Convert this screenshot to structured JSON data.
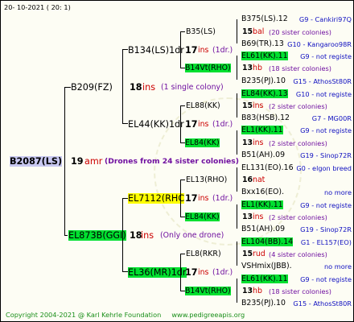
{
  "header": {
    "date": "20-  10-2021  (  20:   1)"
  },
  "root": {
    "id": "B2087(LS)",
    "num": "19",
    "ins": "amr",
    "note": "(Drones from 24 sister colonies)"
  },
  "queen": {
    "id": "B209(FZ)",
    "num": "18",
    "ins": "ins",
    "note": "(1 single colony)",
    "q1": {
      "id": "B134(LS)1dr",
      "num": "17",
      "ins": "ins",
      "note": "(1dr.)"
    },
    "q2": {
      "id": "EL44(KK)1dr",
      "num": "17",
      "ins": "ins",
      "note": "(1dr.)"
    }
  },
  "drone": {
    "id": "EL873B(GGI)",
    "num": "18",
    "ins": "ins",
    "note": "(Only one drone)",
    "q1": {
      "id": "EL7112(RHC",
      "num": "17",
      "ins": "ins",
      "note": "(1dr.)"
    },
    "q2": {
      "id": "EL36(MR)1dr",
      "num": "17",
      "ins": "ins",
      "note": "(1dr.)"
    }
  },
  "gen3": [
    {
      "id": "B35(LS)"
    },
    {
      "id": "B14Vt(RHO)"
    },
    {
      "id": "EL88(KK)"
    },
    {
      "id": "EL84(KK)"
    },
    {
      "id": "EL13(RHO)"
    },
    {
      "id": "EL84(KK)"
    },
    {
      "id": "EL8(RKR)"
    },
    {
      "id": "B14Vt(RHO)"
    }
  ],
  "gen4": [
    {
      "id": "B375(LS).12",
      "tail": "G9 - Cankiri97Q",
      "mid": false
    },
    {
      "num": "15",
      "ins": "bal",
      "note": "(20 sister colonies)",
      "mid": true
    },
    {
      "id": "B69(TR).13",
      "tail": "G10 - Kangaroo98R",
      "mid": false
    },
    {
      "id": "EL61(KK).11",
      "tail": "G9 - not registe",
      "mid": false
    },
    {
      "num": "13",
      "ins": "hb",
      "note": "(18 sister colonies)",
      "mid": true
    },
    {
      "id": "B235(PJ).10",
      "tail": "G15 - AthosSt80R",
      "mid": false
    },
    {
      "id": "EL84(KK).13",
      "tail": "G10 - not registe",
      "mid": false
    },
    {
      "num": "15",
      "ins": "ins",
      "note": "(2 sister colonies)",
      "mid": true
    },
    {
      "id": "B83(HSB).12",
      "tail": "G7 - MG00R",
      "mid": false
    },
    {
      "id": "EL1(KK).11",
      "tail": "G9 - not registe",
      "mid": false
    },
    {
      "num": "13",
      "ins": "ins",
      "note": "(2 sister colonies)",
      "mid": true
    },
    {
      "id": "B51(AH).09",
      "tail": "G19 - Sinop72R",
      "mid": false
    },
    {
      "id": "EL131(EO).16",
      "tail": "G0 - elgon breed",
      "mid": false
    },
    {
      "num": "16",
      "ins": "nat",
      "note": "",
      "mid": true
    },
    {
      "id": "Bxx16(EO).",
      "tail": "no more",
      "mid": false
    },
    {
      "id": "EL1(KK).11",
      "tail": "G9 - not registe",
      "mid": false
    },
    {
      "num": "13",
      "ins": "ins",
      "note": "(2 sister colonies)",
      "mid": true
    },
    {
      "id": "B51(AH).09",
      "tail": "G19 - Sinop72R",
      "mid": false
    },
    {
      "id": "EL104(BB).14",
      "tail": "G1 - EL157(EO)",
      "mid": false
    },
    {
      "num": "15",
      "ins": "rud",
      "note": "(4 sister colonies)",
      "mid": true
    },
    {
      "id": "VSHmix(JBB).",
      "tail": "no more",
      "mid": false
    },
    {
      "id": "EL61(KK).11",
      "tail": "G9 - not registe",
      "mid": false
    },
    {
      "num": "13",
      "ins": "hb",
      "note": "(18 sister colonies)",
      "mid": true
    },
    {
      "id": "B235(PJ).10",
      "tail": "G15 - AthosSt80R",
      "mid": false
    }
  ],
  "footer": {
    "copyright": "Copyright 2004-2021 @ Karl Kehrle Foundation",
    "site": "www.pedigreeapis.org"
  }
}
